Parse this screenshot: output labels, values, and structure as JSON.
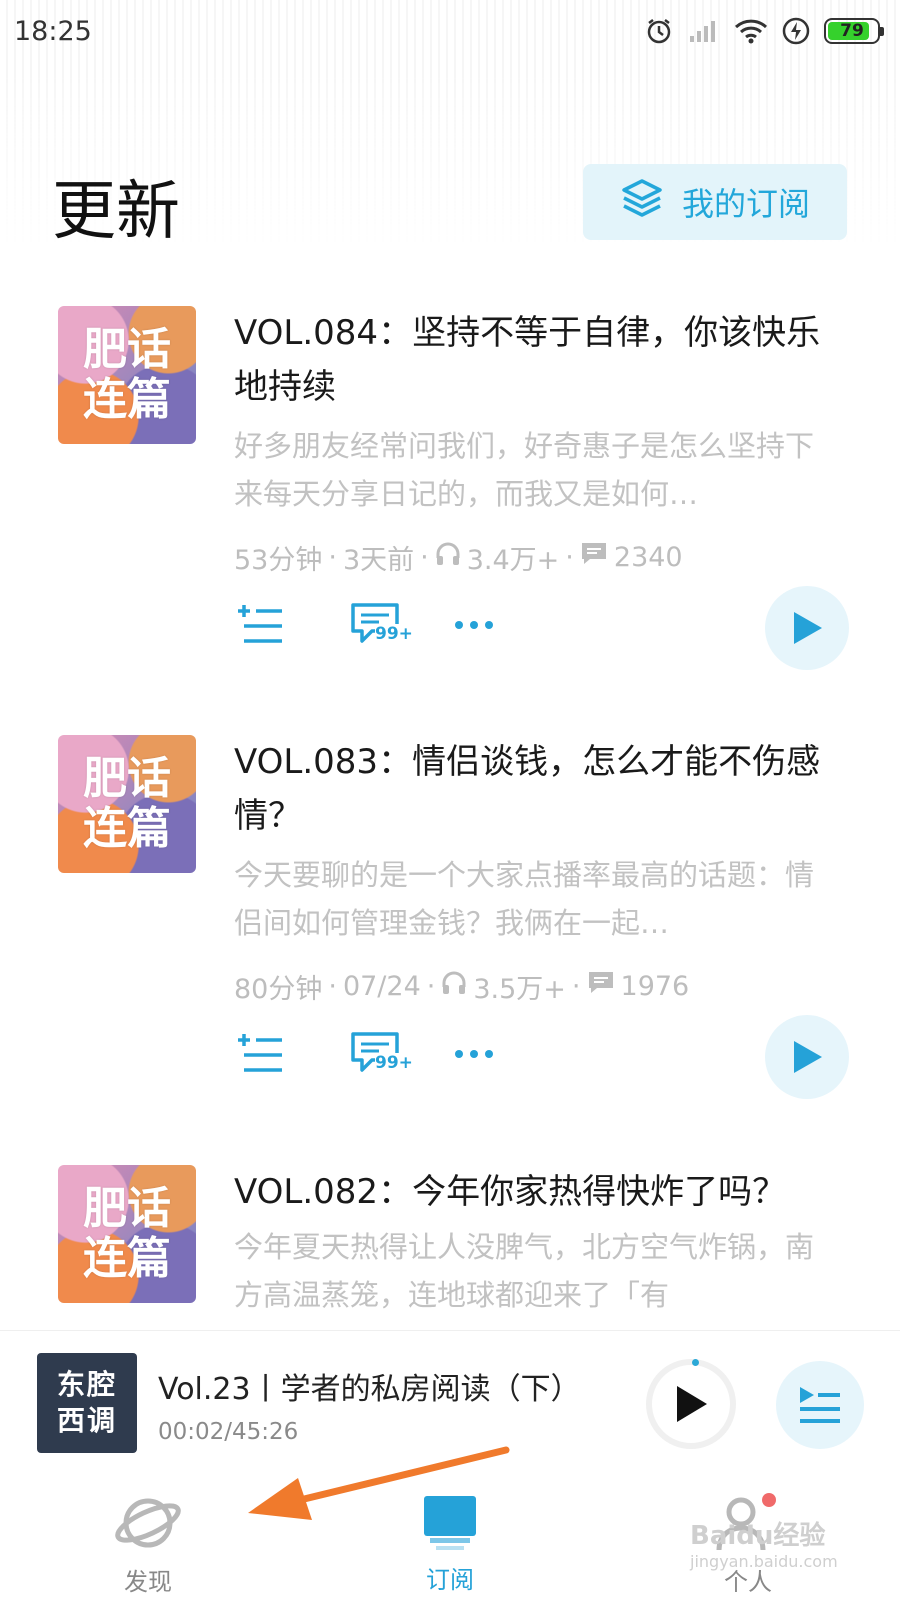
{
  "status_bar": {
    "time": "18:25",
    "battery": "79"
  },
  "header": {
    "title": "更新",
    "subscriptions_label": "我的订阅"
  },
  "cover_text": {
    "line1": "肥话",
    "line2": "连篇"
  },
  "episodes": [
    {
      "title": "VOL.084：坚持不等于自律，你该快乐地持续",
      "description": "好多朋友经常问我们，好奇惠子是怎么坚持下来每天分享日记的，而我又是如何…",
      "duration": "53分钟",
      "date": "3天前",
      "plays": "3.4万+",
      "comments": "2340",
      "comment_badge": "99+"
    },
    {
      "title": "VOL.083：情侣谈钱，怎么才能不伤感情？",
      "description": "今天要聊的是一个大家点播率最高的话题：情侣间如何管理金钱？我俩在一起…",
      "duration": "80分钟",
      "date": "07/24",
      "plays": "3.5万+",
      "comments": "1976",
      "comment_badge": "99+"
    },
    {
      "title": "VOL.082：今年你家热得快炸了吗？",
      "description": "今年夏天热得让人没脾气，北方空气炸锅，南方高温蒸笼，连地球都迎来了「有"
    }
  ],
  "player": {
    "cover_line1": "东腔",
    "cover_line2": "西调",
    "title": "Vol.23丨学者的私房阅读（下）",
    "time": "00:02/45:26"
  },
  "tabs": {
    "discover": "发现",
    "subscribe": "订阅",
    "profile": "个人"
  },
  "watermark": {
    "line1": "Baidu经验",
    "line2": "jingyan.baidu.com"
  },
  "colors": {
    "accent": "#25a2d8",
    "annotation_arrow": "#f07a2c"
  }
}
